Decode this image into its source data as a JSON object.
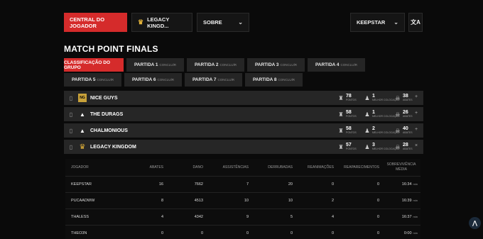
{
  "topbar": {
    "central_label": "CENTRAL DO JOGADOR",
    "legacy_label": "LEGACY KINGD...",
    "sobre_label": "SOBRE",
    "player_select": "KEEPSTAR",
    "lang_icon": "translate-icon"
  },
  "title": "MATCH POINT FINALS",
  "tabs": [
    {
      "label": "CLASSIFICAÇÃO DO GRUPO",
      "sub": ""
    },
    {
      "label": "PARTIDA 1",
      "sub": "CONCLUÍR"
    },
    {
      "label": "PARTIDA 2",
      "sub": "CONCLUÍR"
    },
    {
      "label": "PARTIDA 3",
      "sub": "CONCLUÍR"
    },
    {
      "label": "PARTIDA 4",
      "sub": "CONCLUÍR"
    },
    {
      "label": "PARTIDA 5",
      "sub": "CONCLUÍR"
    },
    {
      "label": "PARTIDA 6",
      "sub": "CONCLUÍR"
    },
    {
      "label": "PARTIDA 7",
      "sub": "CONCLUÍR"
    },
    {
      "label": "PARTIDA 8",
      "sub": "CONCLUÍR"
    }
  ],
  "teams": [
    {
      "name": "NICE GUYS",
      "points": "78",
      "points_label": "PONTOS",
      "best_pos": "1",
      "best_pos_label": "MELHOR COLOCAÇÃO",
      "kills": "38",
      "kills_label": "ABATES",
      "expand": "+"
    },
    {
      "name": "THE DURAGS",
      "points": "58",
      "points_label": "PONTOS",
      "best_pos": "1",
      "best_pos_label": "MELHOR COLOCAÇÃO",
      "kills": "26",
      "kills_label": "ABATES",
      "expand": "+"
    },
    {
      "name": "CHALMONIOUS",
      "points": "58",
      "points_label": "PONTOS",
      "best_pos": "2",
      "best_pos_label": "MELHOR COLOCAÇÃO",
      "kills": "40",
      "kills_label": "ABATES",
      "expand": "+"
    },
    {
      "name": "LEGACY KINGDOM",
      "points": "57",
      "points_label": "PONTOS",
      "best_pos": "3",
      "best_pos_label": "MELHOR COLOCAÇÃO",
      "kills": "28",
      "kills_label": "ABATES",
      "expand": "×"
    }
  ],
  "players": {
    "headers": [
      "JOGADOR",
      "ABATES",
      "DANO",
      "ASSISTÊNCIAS",
      "DERRUBADAS",
      "REANIMAÇÕES",
      "REAPARECIMENTOS",
      "SOBREVIVÊNCIA MÉDIA"
    ],
    "rows": [
      {
        "name": "KEEPSTAR",
        "kills": "16",
        "damage": "7662",
        "assists": "7",
        "knocks": "20",
        "revives": "0",
        "respawns": "0",
        "survival": "16:34",
        "unit": "min"
      },
      {
        "name": "PUCAADWW",
        "kills": "8",
        "damage": "4513",
        "assists": "10",
        "knocks": "10",
        "revives": "2",
        "respawns": "0",
        "survival": "16:39",
        "unit": "min"
      },
      {
        "name": "THALESS",
        "kills": "4",
        "damage": "4342",
        "assists": "9",
        "knocks": "5",
        "revives": "4",
        "respawns": "0",
        "survival": "16:37",
        "unit": "min"
      },
      {
        "name": "THEO3N",
        "kills": "0",
        "damage": "0",
        "assists": "0",
        "knocks": "0",
        "revives": "0",
        "respawns": "0",
        "survival": "0:00",
        "unit": "min"
      }
    ]
  },
  "fab": "⋀"
}
